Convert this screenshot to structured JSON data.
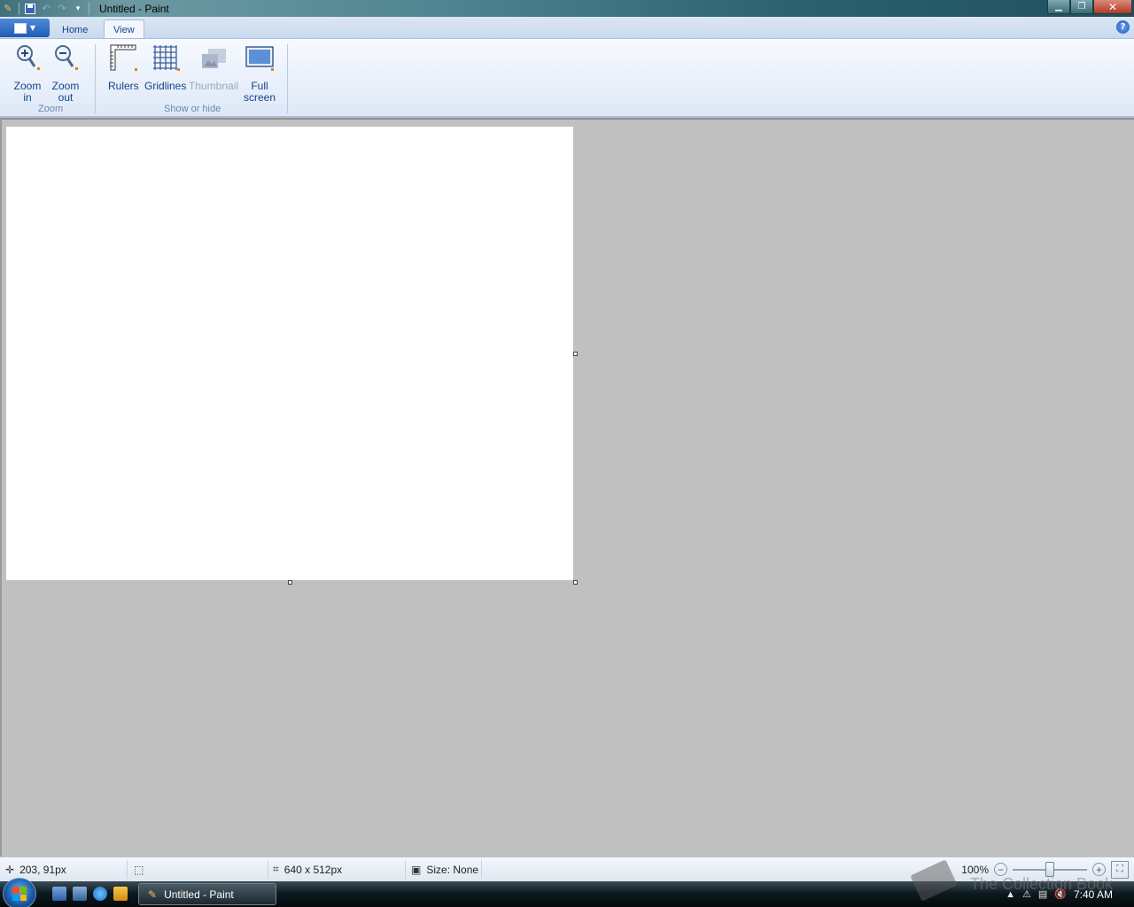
{
  "window": {
    "title": "Untitled - Paint"
  },
  "tabs": [
    {
      "label": "Home"
    },
    {
      "label": "View"
    }
  ],
  "ribbon": {
    "zoom_group": {
      "label": "Zoom",
      "zoom_in": "Zoom\nin",
      "zoom_out": "Zoom\nout"
    },
    "show_group": {
      "label": "Show or hide",
      "rulers": "Rulers",
      "gridlines": "Gridlines",
      "thumbnail": "Thumbnail",
      "full_screen": "Full\nscreen"
    }
  },
  "status": {
    "cursor_pos": "203, 91px",
    "canvas_size": "640 x 512px",
    "file_size": "Size: None",
    "zoom": "100%"
  },
  "taskbar": {
    "task_label": "Untitled - Paint",
    "clock": "7:40 AM"
  },
  "watermark": "The Collection Book"
}
